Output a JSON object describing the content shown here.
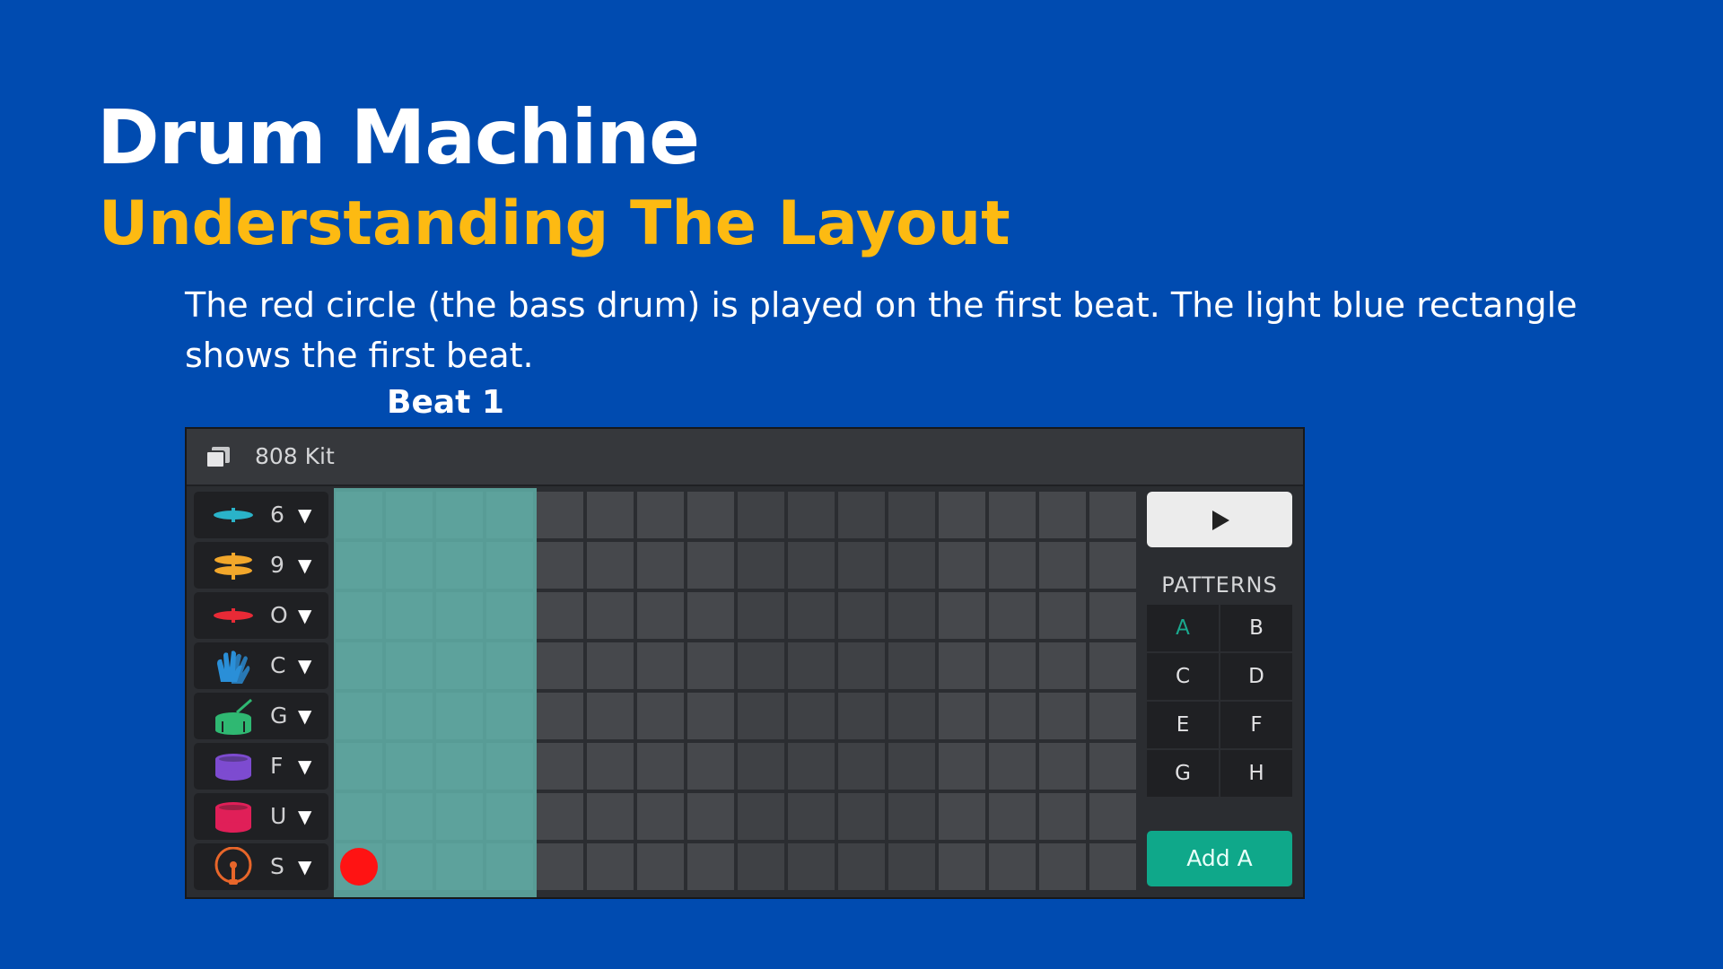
{
  "title": "Drum Machine",
  "subtitle": "Understanding The Layout",
  "description": "The red circle  (the bass drum)  is played on the first beat. The  light blue rectangle shows the first beat.",
  "beat_label": "Beat 1",
  "app": {
    "kit_name": "808 Kit",
    "play_icon": "play-icon",
    "patterns_label": "PATTERNS",
    "add_button": "Add A",
    "active_pattern": "A",
    "patterns": [
      "A",
      "B",
      "C",
      "D",
      "E",
      "F",
      "G",
      "H"
    ],
    "instruments": [
      {
        "key": "6",
        "icon": "cymbal-icon",
        "color": "#2ab3c9"
      },
      {
        "key": "9",
        "icon": "hihat-icon",
        "color": "#f2a72b"
      },
      {
        "key": "O",
        "icon": "cymbal-icon",
        "color": "#e82a36"
      },
      {
        "key": "C",
        "icon": "clap-icon",
        "color": "#2a8fd8"
      },
      {
        "key": "G",
        "icon": "snare-drum-icon",
        "color": "#2fb872"
      },
      {
        "key": "F",
        "icon": "tom-drum-icon",
        "color": "#7d4bd0"
      },
      {
        "key": "U",
        "icon": "floor-tom-icon",
        "color": "#e01f58"
      },
      {
        "key": "S",
        "icon": "bass-drum-icon",
        "color": "#e8662a"
      }
    ],
    "steps": 16,
    "highlighted_beat": 1,
    "active_steps": [
      {
        "row": 8,
        "step": 1
      }
    ],
    "colors": {
      "background": "#004BB0",
      "subtitle": "#FDBA12",
      "hit": "#ff1313",
      "add_button": "#0fa88a"
    }
  }
}
